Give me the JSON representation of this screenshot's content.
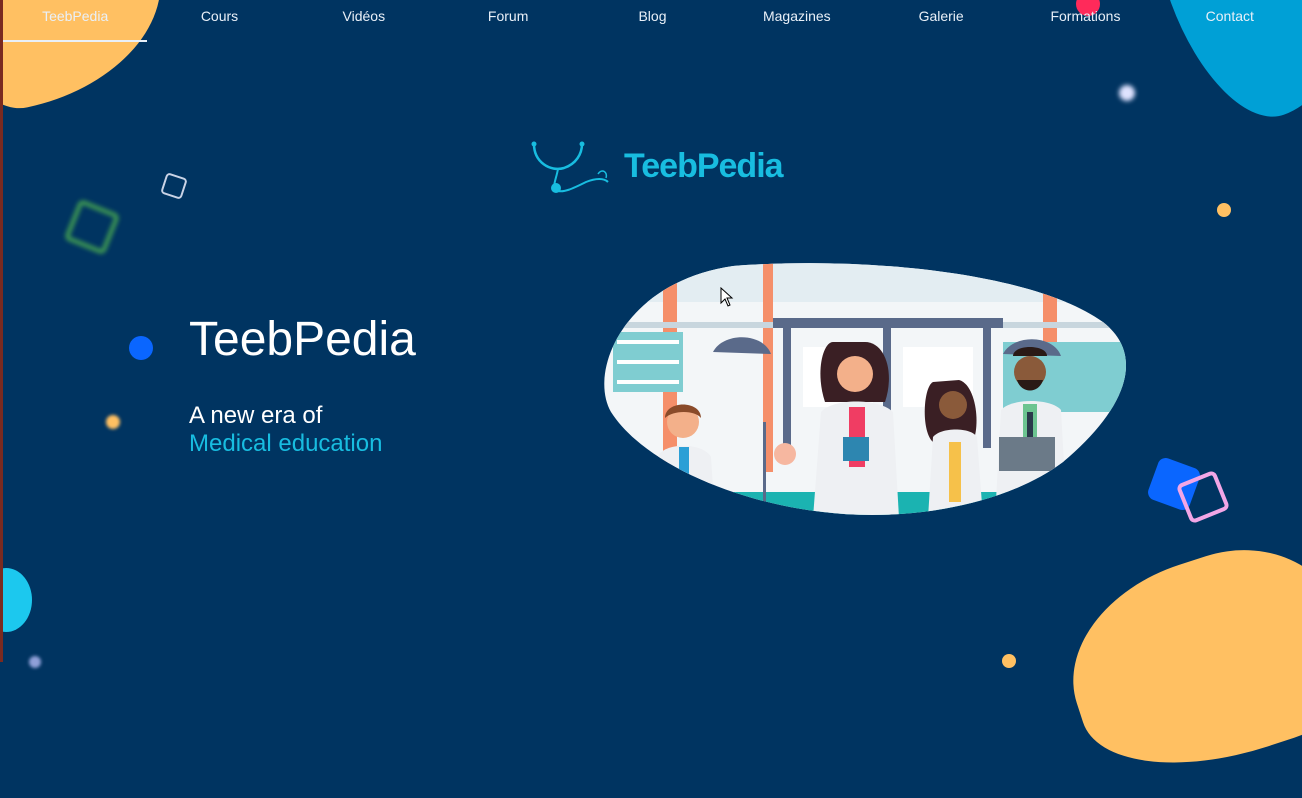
{
  "nav": {
    "items": [
      "TeebPedia",
      "Cours",
      "Vidéos",
      "Forum",
      "Blog",
      "Magazines",
      "Galerie",
      "Formations",
      "Contact"
    ],
    "active_index": 0
  },
  "logo": {
    "text": "TeebPedia",
    "icon": "stethoscope-icon"
  },
  "hero": {
    "title": "TeebPedia",
    "subtitle_line1": "A new era of",
    "subtitle_line2": "Medical education"
  },
  "illustration": {
    "name": "medical-lab-team-illustration"
  },
  "colors": {
    "background": "#003461",
    "accent_cyan": "#18bde0",
    "accent_orange": "#ffc062",
    "accent_blue": "#0a66ff",
    "accent_pink": "#f2a6e6",
    "accent_red": "#ff2a5a"
  }
}
